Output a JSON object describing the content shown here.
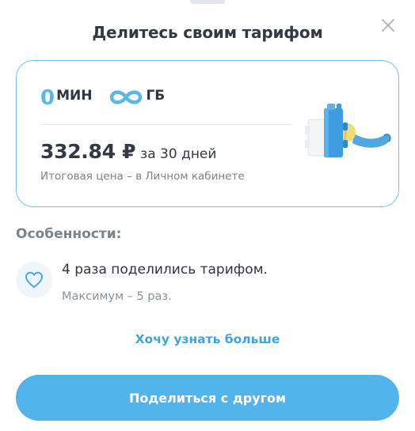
{
  "sheet": {
    "title": "Делитесь своим тарифом",
    "close_icon": "close-icon"
  },
  "tariff": {
    "minutes_value": "0",
    "minutes_unit": "МИН",
    "data_value_icon": "infinity-icon",
    "data_unit": "ГБ",
    "price": "332.84 ₽",
    "period": "за 30 дней",
    "note": "Итоговая цена – в Личном кабинете",
    "illustration": "lego-brick-hand-illustration"
  },
  "features": {
    "heading": "Особенности:",
    "items": [
      {
        "icon": "heart-icon",
        "title": "4 раза поделились тарифом.",
        "subtitle": "Максимум – 5 раз."
      }
    ]
  },
  "actions": {
    "more_link": "Хочу узнать больше",
    "share_button": "Поделиться с другом"
  },
  "colors": {
    "accent": "#52b4ea",
    "link": "#3ba5dd",
    "card_border": "#6fc3e8"
  }
}
